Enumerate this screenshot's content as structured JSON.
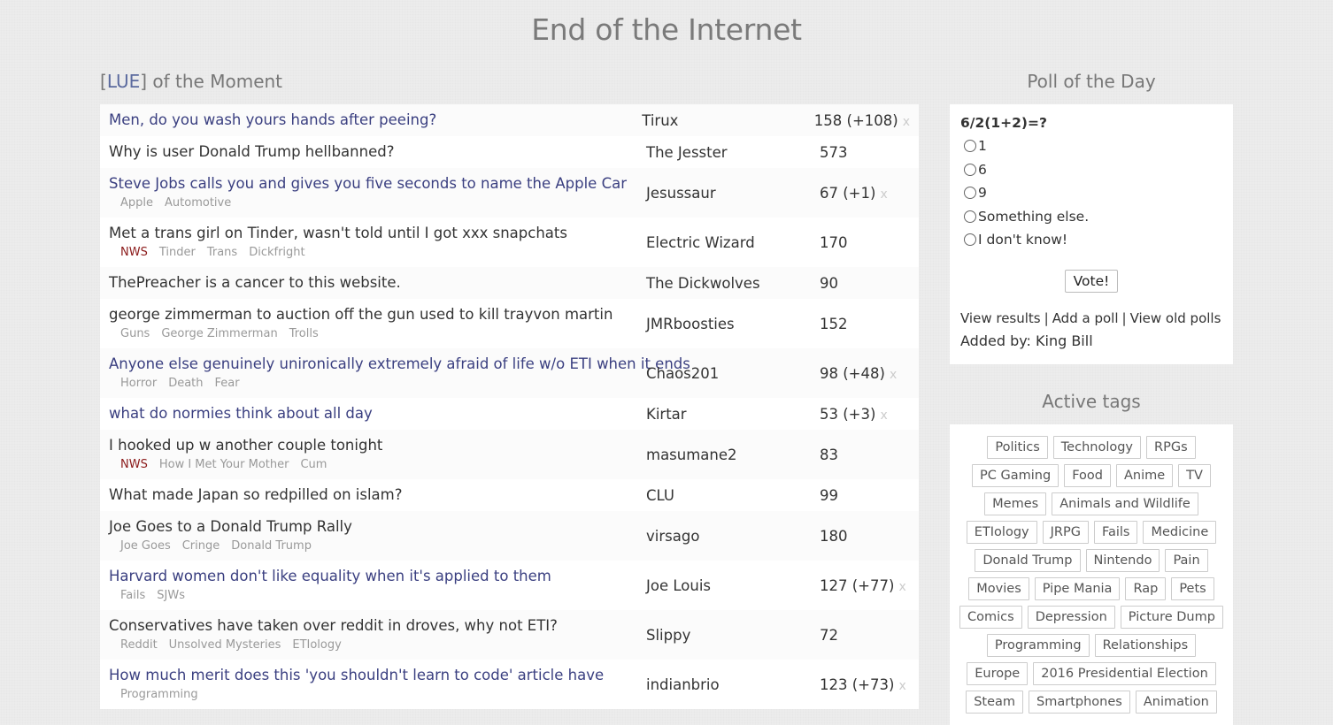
{
  "site": {
    "title": "End of the Internet"
  },
  "lue": {
    "bracket_open": "[",
    "link": "LUE",
    "bracket_close": "]",
    "suffix": " of the Moment"
  },
  "topics": [
    {
      "title": "Men, do you wash yours hands after peeing?",
      "link": true,
      "tags": [],
      "author": "Tirux",
      "count": "158 (+108)",
      "dismiss": "x"
    },
    {
      "title": "Why is user Donald Trump hellbanned?",
      "link": false,
      "tags": [],
      "author": "The Jesster",
      "count": "573"
    },
    {
      "title": "Steve Jobs calls you and gives you five seconds to name the Apple Car",
      "link": true,
      "tags": [
        "Apple",
        "Automotive"
      ],
      "author": "Jesussaur",
      "count": "67 (+1)",
      "dismiss": "x"
    },
    {
      "title": "Met a trans girl on Tinder, wasn't told until I got xxx snapchats",
      "link": false,
      "tags": [
        "NWS",
        "Tinder",
        "Trans",
        "Dickfright"
      ],
      "author": "Electric Wizard",
      "count": "170"
    },
    {
      "title": "ThePreacher is a cancer to this website.",
      "link": false,
      "tags": [],
      "author": "The Dickwolves",
      "count": "90"
    },
    {
      "title": "george zimmerman to auction off the gun used to kill trayvon martin",
      "link": false,
      "tags": [
        "Guns",
        "George Zimmerman",
        "Trolls"
      ],
      "author": "JMRboosties",
      "count": "152"
    },
    {
      "title": "Anyone else genuinely unironically extremely afraid of life w/o ETI when it ends",
      "link": true,
      "tags": [
        "Horror",
        "Death",
        "Fear"
      ],
      "author": "Chaos201",
      "count": "98 (+48)",
      "dismiss": "x"
    },
    {
      "title": "what do normies think about all day",
      "link": true,
      "tags": [],
      "author": "Kirtar",
      "count": "53 (+3)",
      "dismiss": "x"
    },
    {
      "title": "I hooked up w another couple tonight",
      "link": false,
      "tags": [
        "NWS",
        "How I Met Your Mother",
        "Cum"
      ],
      "author": "masumane2",
      "count": "83"
    },
    {
      "title": "What made Japan so redpilled on islam?",
      "link": false,
      "tags": [],
      "author": "CLU",
      "count": "99"
    },
    {
      "title": "Joe Goes to a Donald Trump Rally",
      "link": false,
      "tags": [
        "Joe Goes",
        "Cringe",
        "Donald Trump"
      ],
      "author": "virsago",
      "count": "180"
    },
    {
      "title": "Harvard women don't like equality when it's applied to them",
      "link": true,
      "tags": [
        "Fails",
        "SJWs"
      ],
      "author": "Joe Louis",
      "count": "127 (+77)",
      "dismiss": "x"
    },
    {
      "title": "Conservatives have taken over reddit in droves, why not ETI?",
      "link": false,
      "tags": [
        "Reddit",
        "Unsolved Mysteries",
        "ETIology"
      ],
      "author": "Slippy",
      "count": "72"
    },
    {
      "title": "How much merit does this 'you shouldn't learn to code' article have",
      "link": true,
      "tags": [
        "Programming"
      ],
      "author": "indianbrio",
      "count": "123 (+73)",
      "dismiss": "x"
    }
  ],
  "poll": {
    "heading": "Poll of the Day",
    "question": "6/2(1+2)=?",
    "options": [
      "1",
      "6",
      "9",
      "Something else.",
      "I don't know!"
    ],
    "vote_label": "Vote!",
    "links": {
      "results": "View results",
      "add": "Add a poll",
      "old": "View old polls",
      "sep": "|"
    },
    "added_by": "Added by: King Bill"
  },
  "active_tags": {
    "heading": "Active tags",
    "lines": [
      [
        "Politics",
        "Technology",
        "RPGs"
      ],
      [
        "PC Gaming",
        "Food",
        "Anime",
        "TV"
      ],
      [
        "Memes",
        "Animals and Wildlife"
      ],
      [
        "ETIology",
        "JRPG",
        "Fails",
        "Medicine"
      ],
      [
        "Donald Trump",
        "Nintendo",
        "Pain"
      ],
      [
        "Movies",
        "Pipe Mania",
        "Rap",
        "Pets"
      ],
      [
        "Comics",
        "Depression",
        "Picture Dump"
      ],
      [
        "Programming",
        "Relationships"
      ],
      [
        "Europe",
        "2016 Presidential Election"
      ],
      [
        "Steam",
        "Smartphones",
        "Animation"
      ]
    ]
  },
  "colors": {
    "link": "#3a3f80",
    "nws": "#8b1a1a",
    "muted": "#999999",
    "title": "#7a7a7a"
  }
}
